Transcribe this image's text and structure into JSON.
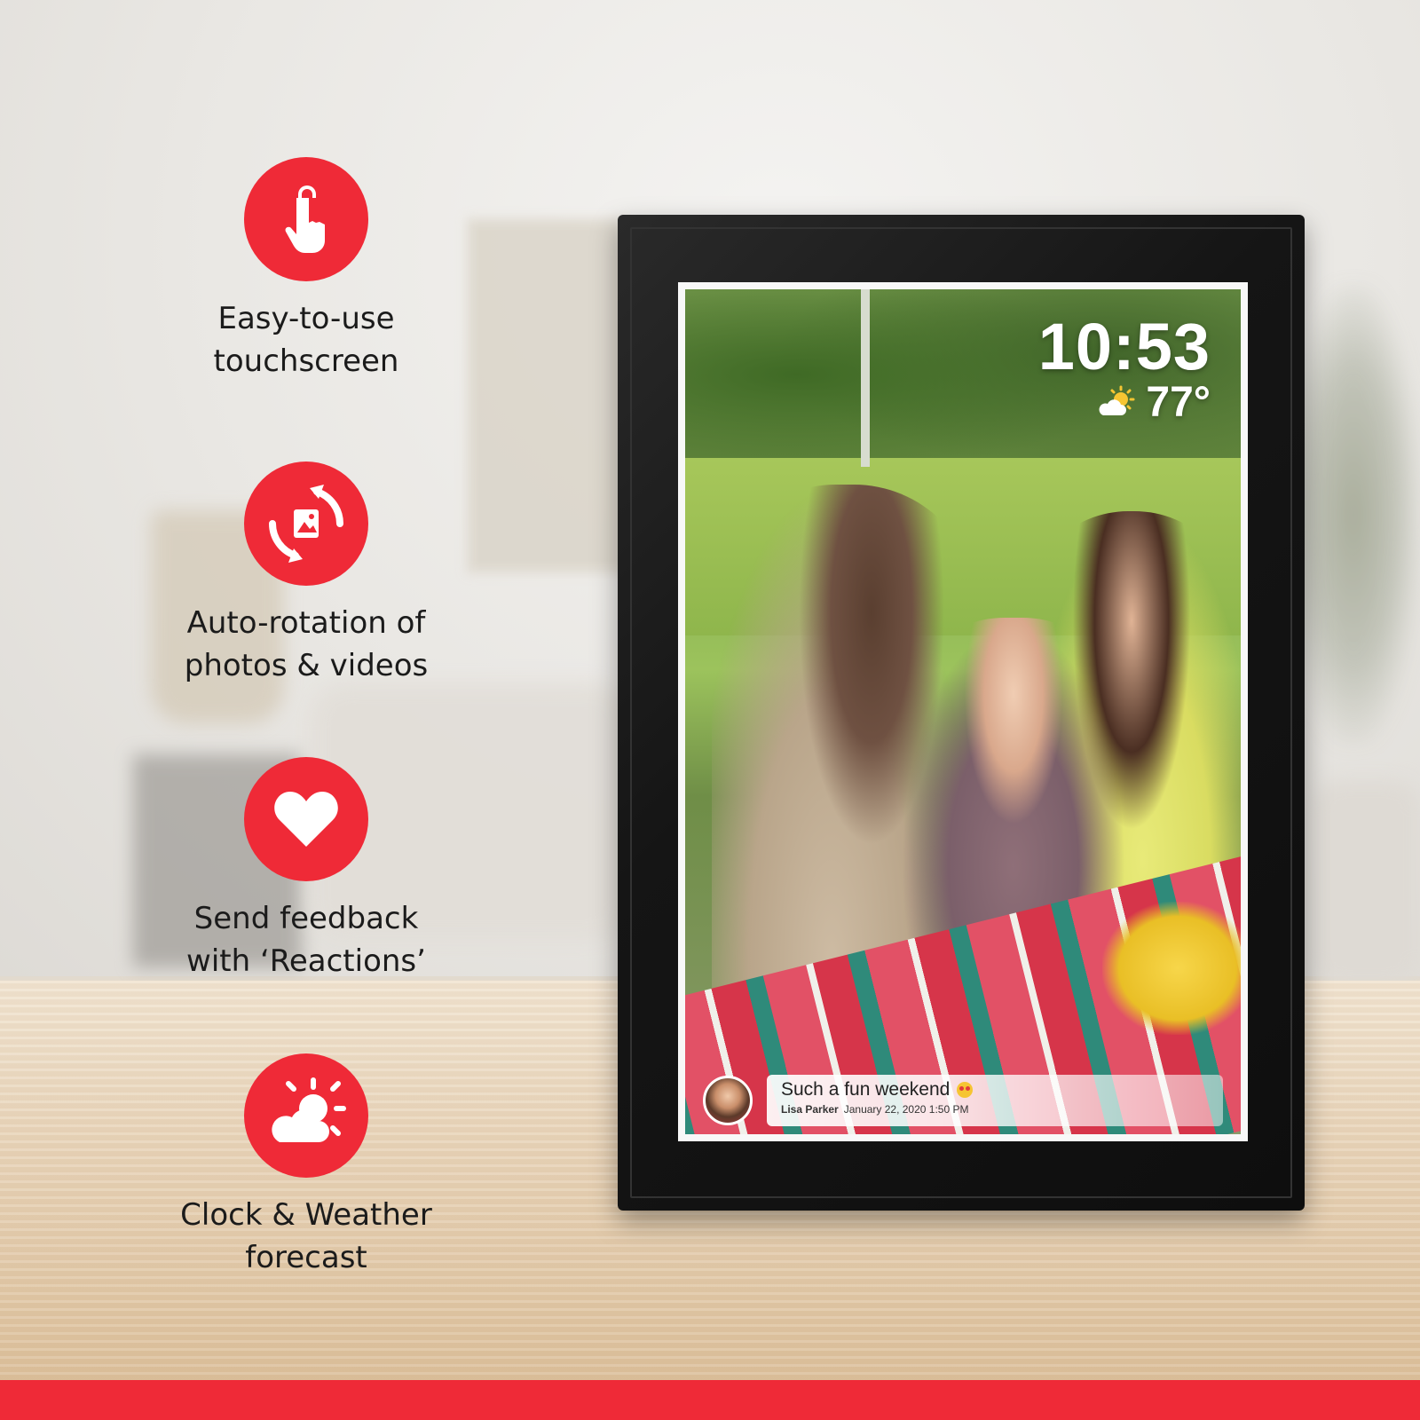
{
  "features": [
    {
      "icon": "touch-icon",
      "lines": [
        "Easy-to-use",
        "touchscreen"
      ]
    },
    {
      "icon": "rotate-photo-icon",
      "lines": [
        "Auto-rotation of",
        "photos & videos"
      ]
    },
    {
      "icon": "heart-icon",
      "lines": [
        "Send feedback",
        "with ‘Reactions’"
      ]
    },
    {
      "icon": "sun-cloud-icon",
      "lines": [
        "Clock & Weather",
        "forecast"
      ]
    }
  ],
  "frame": {
    "clock": "10:53",
    "temperature": "77°",
    "weather_icon": "partly-sunny-icon",
    "caption": {
      "text": "Such a fun weekend",
      "emoji": "heart-eyes-emoji",
      "author": "Lisa Parker",
      "timestamp": "January 22, 2020 1:50 PM"
    }
  },
  "colors": {
    "accent": "#ef2a37",
    "frame": "#151515",
    "label": "#1b1b1b"
  }
}
